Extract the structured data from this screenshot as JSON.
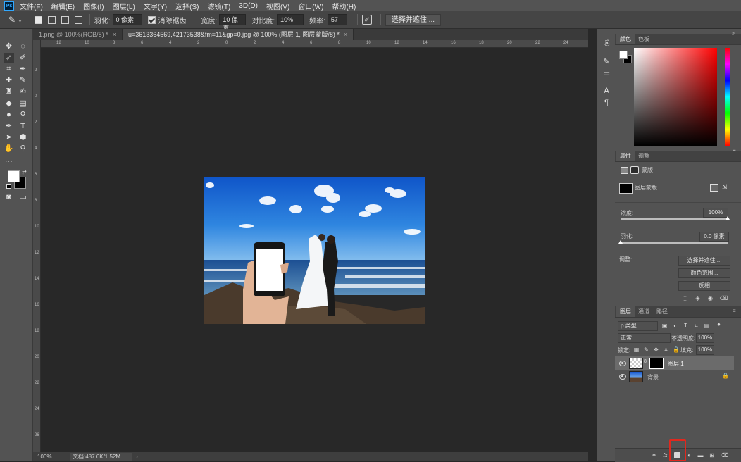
{
  "menu": [
    "文件(F)",
    "编辑(E)",
    "图像(I)",
    "图层(L)",
    "文字(Y)",
    "选择(S)",
    "滤镜(T)",
    "3D(D)",
    "视图(V)",
    "窗口(W)",
    "帮助(H)"
  ],
  "options": {
    "feather_label": "羽化:",
    "feather_value": "0 像素",
    "antialias_label": "消除锯齿",
    "width_label": "宽度:",
    "width_value": "10 像素",
    "contrast_label": "对比度:",
    "contrast_value": "10%",
    "frequency_label": "频率:",
    "frequency_value": "57",
    "select_mask_button": "选择并遮住 ..."
  },
  "tabs": [
    {
      "label": "1.png @ 100%(RGB/8) *",
      "close": "×"
    },
    {
      "label": "u=3613364569,42173538&fm=11&gp=0.jpg @ 100% (图层 1, 图层蒙版/8) *",
      "close": "×"
    }
  ],
  "ruler": {
    "top": [
      "12",
      "10",
      "8",
      "6",
      "4",
      "2",
      "0",
      "2",
      "4",
      "6",
      "8",
      "10",
      "12",
      "14",
      "16",
      "18",
      "20",
      "22",
      "24"
    ],
    "left": [
      "2",
      "0",
      "2",
      "4",
      "6",
      "8",
      "10",
      "12",
      "14",
      "16",
      "18",
      "20",
      "22",
      "24",
      "26"
    ]
  },
  "status": {
    "zoom": "100%",
    "doc": "文档:487.6K/1.52M",
    "arrow": "›"
  },
  "color_panel": {
    "tabs": [
      "颜色",
      "色板"
    ],
    "hue_color": "#ff0000"
  },
  "properties_panel": {
    "tabs": [
      "属性",
      "调整"
    ],
    "mask_label": "蒙版",
    "layer_mask_label": "图层蒙版",
    "density_label": "浓度:",
    "density_value": "100%",
    "density": 1.0,
    "feather_label": "羽化:",
    "feather_value": "0.0 像素",
    "feather": 0.0,
    "adjust_label": "调整:",
    "select_mask_button": "选择并遮住 ...",
    "color_range_button": "颜色范围...",
    "invert_button": "反相"
  },
  "layers_panel": {
    "tabs": [
      "图层",
      "通道",
      "路径"
    ],
    "filter_label": "ρ 类型",
    "blend_mode": "正常",
    "opacity_label": "不透明度:",
    "opacity_value": "100%",
    "lock_label": "锁定:",
    "fill_label": "填充:",
    "fill_value": "100%",
    "layers": [
      {
        "name": "图层 1",
        "selected": true,
        "has_mask": true
      },
      {
        "name": "背景",
        "selected": false,
        "locked": true
      }
    ],
    "bottom_icons": [
      "link-icon",
      "fx-icon",
      "add-mask-icon",
      "adjustment-icon",
      "group-icon",
      "new-layer-icon",
      "trash-icon"
    ],
    "fx_label": "fx"
  },
  "colors": {
    "app_bg": "#535353",
    "canvas_bg": "#282828",
    "highlight": "#e0281e"
  }
}
